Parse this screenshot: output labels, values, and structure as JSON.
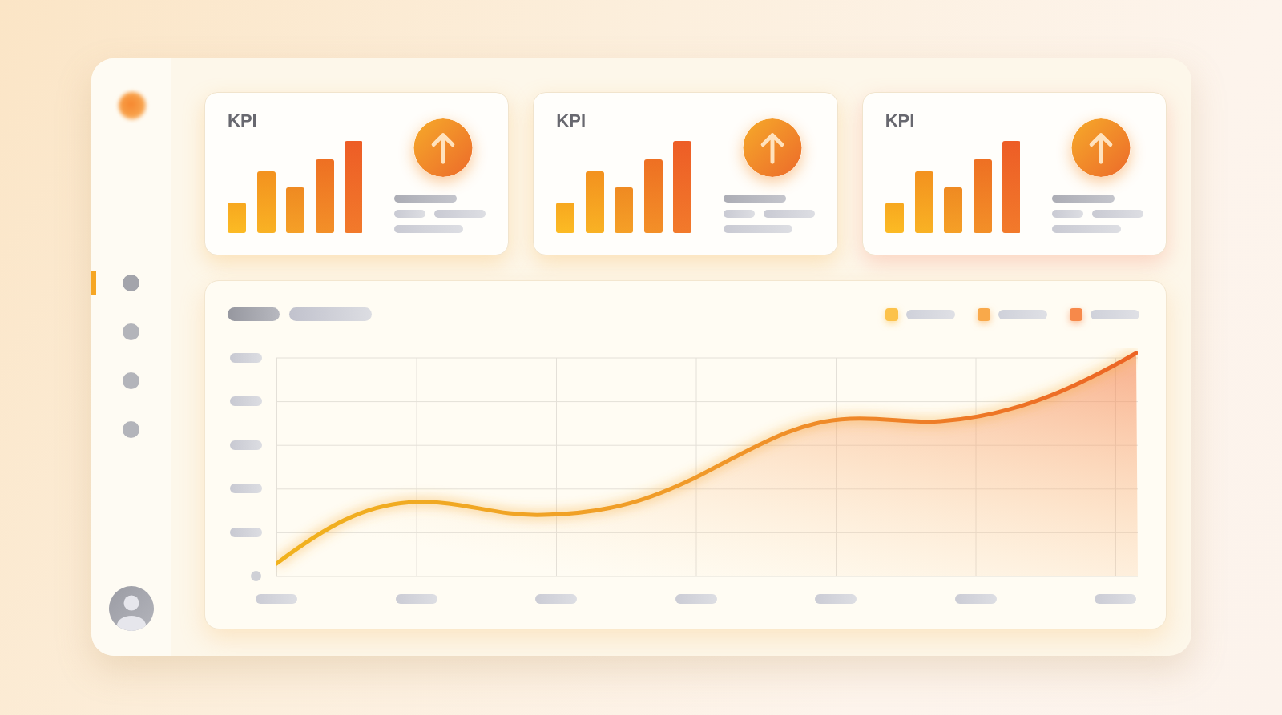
{
  "sidebar": {
    "items": [
      {
        "selected": true
      },
      {
        "selected": false
      },
      {
        "selected": false
      },
      {
        "selected": false
      }
    ]
  },
  "kpi_cards": [
    {
      "title": "KPI"
    },
    {
      "title": "KPI"
    },
    {
      "title": "KPI"
    }
  ],
  "chart": {
    "legend": [
      {
        "color": "#fcc24a"
      },
      {
        "color": "#f9a94a"
      },
      {
        "color": "#f7894a"
      }
    ]
  }
}
